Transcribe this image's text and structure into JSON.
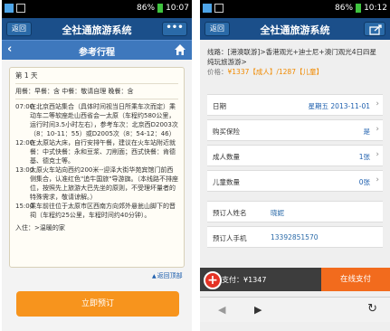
{
  "left": {
    "status": {
      "time": "10:07",
      "battery": "86%"
    },
    "header": {
      "back_label": "返回",
      "title": "全社通旅游系统",
      "more_label": "•••"
    },
    "subheader": {
      "back": "‹",
      "title": "参考行程"
    },
    "card": {
      "day": "第 1 天",
      "meals": "用餐：早餐：含 中餐：敬请自理 晚餐：含",
      "schedule": [
        {
          "time": "07:00",
          "text": "在北京西站集合（具体时间视当日所乘车次而定）乘动车二等软座赴山西省会一太原（车程约580公里，运行时间3.5小时左右），参考车次：北京西D2003次（8：10-11：55）或D2005次（8：54-12：46）"
        },
        {
          "time": "12:00",
          "text": "在太原站大床，自行安排午餐，建议在火车站附近就餐：中式快餐：永和豆浆、刀削面；西式快餐：肯德基、德克士等。"
        },
        {
          "time": "13:00",
          "text": "太原火车站向西约200米--迎泽大街华苑宾馆门前西侧集合，认准红色\"追牛国旅\"导游旗。（本线路不排座位，按照先上旅游大巴先坐的原则，不受理坏量者的特殊需求，敬请谅解。）"
        },
        {
          "time": "15:00",
          "text": "乘车前往位于太原市区西南方向郊外悬瓮山脚下的晋祠（车程约25公里，车程时间约40分钟）。"
        }
      ],
      "stay": "入住：>温暖的家"
    },
    "back_top": "返回顶部",
    "book_button": "立即预订"
  },
  "right": {
    "status": {
      "time": "10:12",
      "battery": "86%"
    },
    "header": {
      "back_label": "返回",
      "title": "全社通旅游系统"
    },
    "route": {
      "label": "线路：",
      "text": "[港澳联游]>香港观光+迪士尼+澳门观光4日四星纯玩旅游游>",
      "price_label": "价格：",
      "price_adult": "¥1337【成人】",
      "sep": "/",
      "price_child": "1287【儿童】"
    },
    "rows": [
      {
        "label": "日期",
        "value": "星期五    2013-11-01"
      },
      {
        "label": "购买保险",
        "value": "是"
      },
      {
        "label": "成人数量",
        "value": "1张"
      },
      {
        "label": "儿童数量",
        "value": "0张"
      },
      {
        "label": "预订人姓名",
        "value": "晓妮"
      },
      {
        "label": "预订人手机",
        "value": "13392851570"
      }
    ],
    "pay": {
      "total": "支付：¥1347",
      "button": "在线支付"
    }
  },
  "colors": {
    "header": "#1b4f8a",
    "subheader": "#3e78bd",
    "book": "#f7941d",
    "pay": "#f26b1d"
  }
}
